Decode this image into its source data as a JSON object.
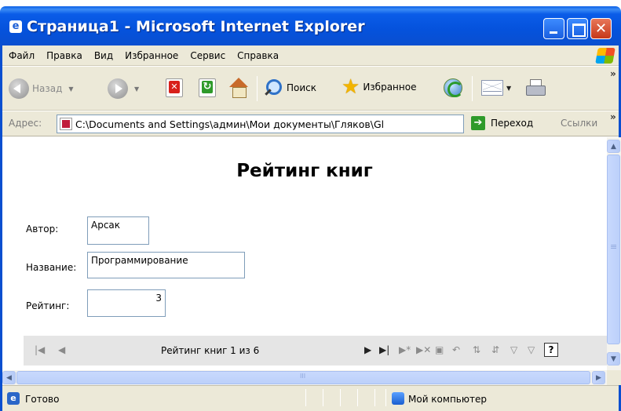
{
  "window": {
    "title": "Страница1 - Microsoft Internet Explorer"
  },
  "menu": {
    "items": [
      "Файл",
      "Правка",
      "Вид",
      "Избранное",
      "Сервис",
      "Справка"
    ]
  },
  "toolbar": {
    "back_label": "Назад",
    "search_label": "Поиск",
    "favorites_label": "Избранное"
  },
  "address": {
    "label": "Адрес:",
    "value": "C:\\Documents and Settings\\админ\\Мои документы\\Гляков\\Gl",
    "go_label": "Переход",
    "links_label": "Ссылки"
  },
  "page": {
    "title": "Рейтинг книг",
    "fields": {
      "author_label": "Автор:",
      "author_value": "Арсак",
      "name_label": "Название:",
      "name_value": "Программирование",
      "rating_label": "Рейтинг:",
      "rating_value": "3"
    },
    "record_nav": {
      "label": "Рейтинг книг 1 из 6"
    }
  },
  "status": {
    "text": "Готово",
    "zone": "Мой компьютер"
  },
  "colors": {
    "titlebar": "#0552dc",
    "chrome": "#ece9d8",
    "nav_bar": "#e5e5e5",
    "scrollbar": "#c8d9fd"
  }
}
